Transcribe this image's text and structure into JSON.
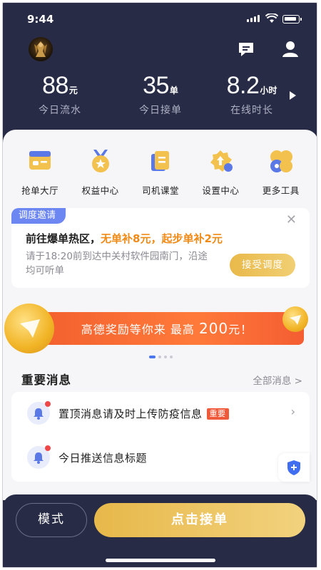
{
  "status_bar": {
    "time": "9:44"
  },
  "stats": [
    {
      "value": "88",
      "unit": "元",
      "label": "今日流水"
    },
    {
      "value": "35",
      "unit": "单",
      "label": "今日接单"
    },
    {
      "value": "8.2",
      "unit": "小时",
      "label": "在线时长"
    }
  ],
  "grid": [
    {
      "label": "抢单大厅",
      "icon": "order-hall-icon"
    },
    {
      "label": "权益中心",
      "icon": "benefits-medal-icon"
    },
    {
      "label": "司机课堂",
      "icon": "driver-class-book-icon"
    },
    {
      "label": "设置中心",
      "icon": "settings-gear-icon"
    },
    {
      "label": "更多工具",
      "icon": "more-tools-icon"
    }
  ],
  "dispatch": {
    "tag": "调度邀请",
    "title_prefix": "前往爆单热区，",
    "title_highlight": "无单补8元，起步单补2元",
    "desc": "请于18:20前到达中关村软件园南门，沿途均可听单",
    "accept_label": "接受调度"
  },
  "banner": {
    "text_prefix": "高德奖励等你来 最高",
    "text_amount": "200",
    "text_suffix": "元！"
  },
  "messages": {
    "title": "重要消息",
    "all_label": "全部消息 >",
    "items": [
      {
        "text": "置顶消息请及时上传防疫信息",
        "badge": "重要"
      },
      {
        "text": "今日推送信息标题",
        "badge": ""
      }
    ]
  },
  "bottom": {
    "mode_label": "模式",
    "go_label": "点击接单"
  },
  "colors": {
    "header_bg": "#272b45",
    "accent_gold": "#e9b94a",
    "accent_orange": "#f08a17",
    "tag_blue": "#6c86f2",
    "banner_red": "#f25f2e"
  }
}
